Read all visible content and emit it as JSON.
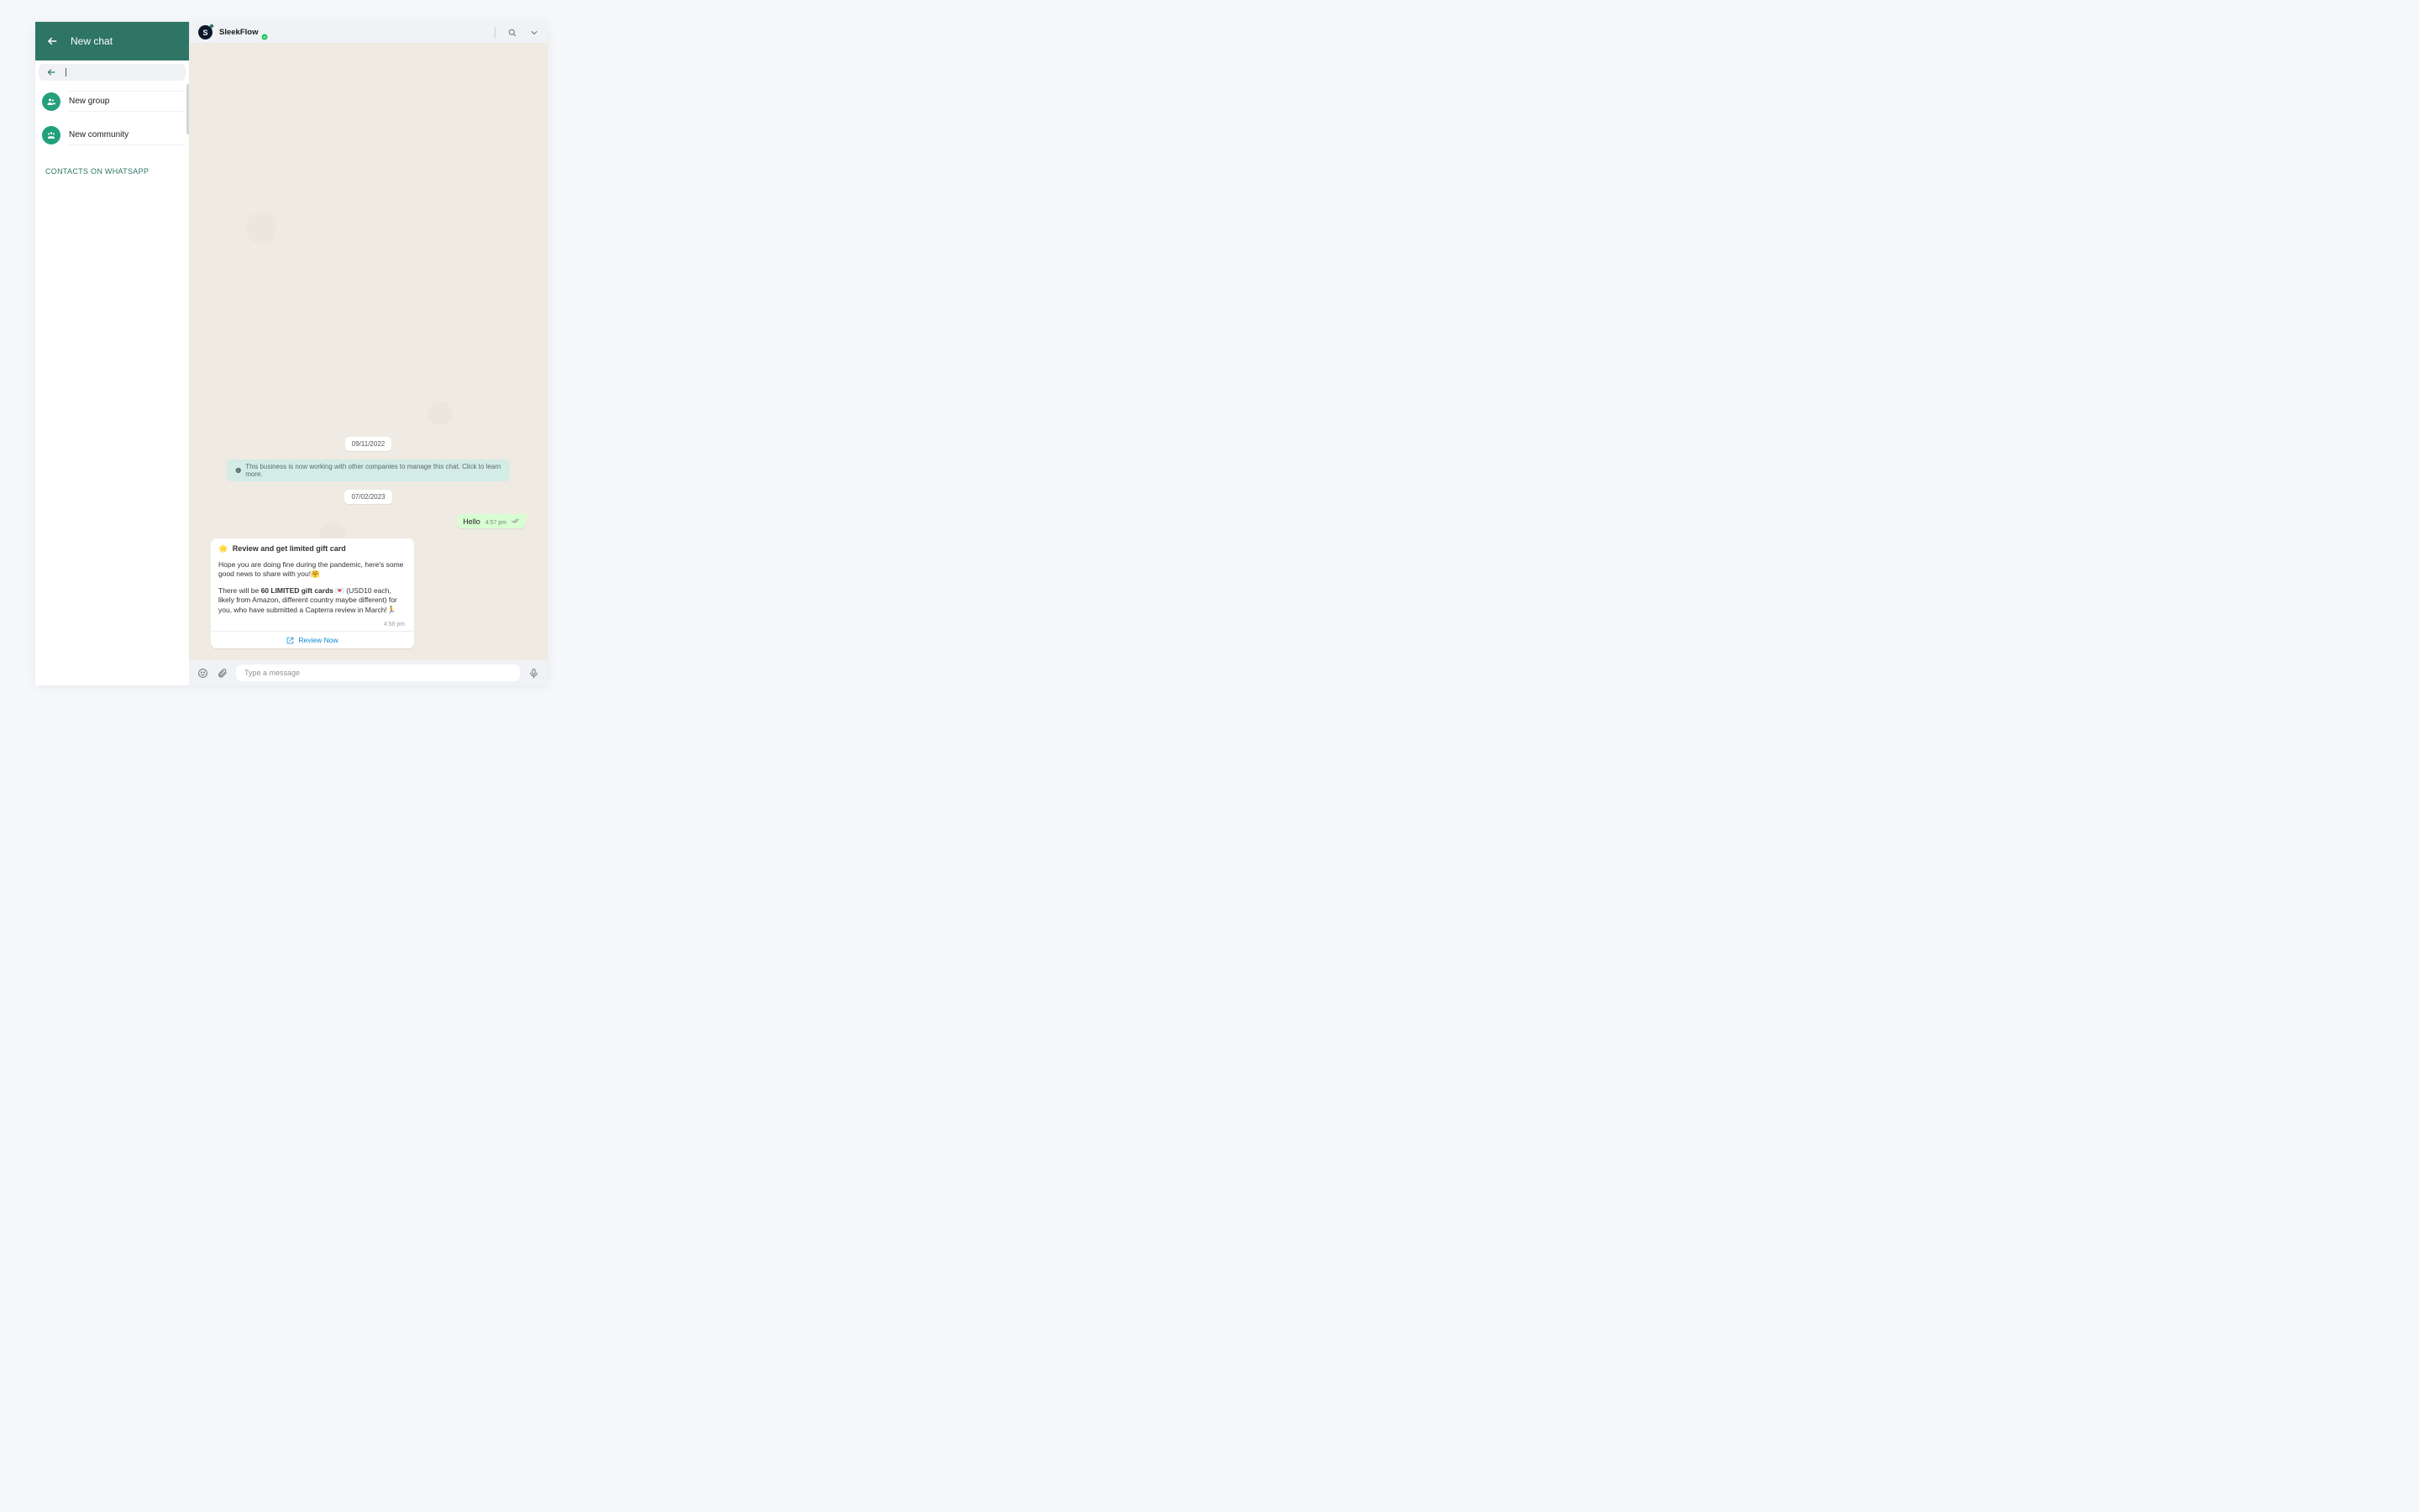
{
  "sidebar": {
    "title": "New chat",
    "items": [
      {
        "label": "New group"
      },
      {
        "label": "New community"
      }
    ],
    "section_title": "CONTACTS ON WHATSAPP"
  },
  "chat": {
    "contact_name": "SleekFlow",
    "avatar_letter": "S",
    "dates": {
      "d1": "09/11/2022",
      "d2": "07/02/2023"
    },
    "system_notice": "This business is now working with other companies to manage this chat. Click to learn more.",
    "out_msg": {
      "text": "Hello",
      "time": "4:57 pm"
    },
    "in_msg": {
      "title_emoji": "🌟",
      "title": "Review and get limited gift card",
      "p1_a": "Hope you are doing fine during the pandemic, here's some good news to share with you!",
      "p1_emoji": "🤗",
      "p2_a": "There will be ",
      "p2_bold": "60 LIMITED gift cards",
      "p2_b": " 💌 (USD10 each, likely from Amazon, different country maybe different) for you, who have submitted a Capterra review in March!",
      "p2_emoji": "🏃",
      "time": "4:58 pm",
      "action": "Review Now"
    },
    "composer_placeholder": "Type a message"
  }
}
